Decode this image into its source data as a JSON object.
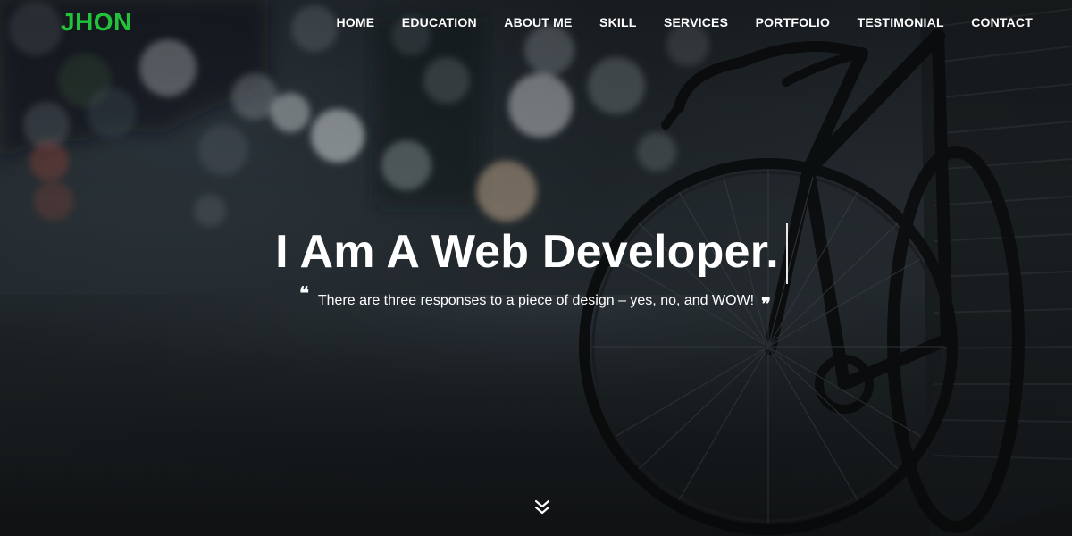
{
  "brand": {
    "logo_text": "JHON",
    "logo_color": "#22c33a"
  },
  "nav": {
    "items": [
      {
        "label": "HOME"
      },
      {
        "label": "EDUCATION"
      },
      {
        "label": "ABOUT ME"
      },
      {
        "label": "SKILL"
      },
      {
        "label": "SERVICES"
      },
      {
        "label": "PORTFOLIO"
      },
      {
        "label": "TESTIMONIAL"
      },
      {
        "label": "CONTACT"
      }
    ]
  },
  "hero": {
    "headline": "I Am A Web Developer.",
    "quote": "There are three responses to a piece of design – yes, no, and WOW!",
    "quote_open_mark": "❝",
    "quote_close_mark": "❞",
    "background_image": "blurred street with bicycle",
    "scroll_icon": "double-chevron-down-icon"
  }
}
